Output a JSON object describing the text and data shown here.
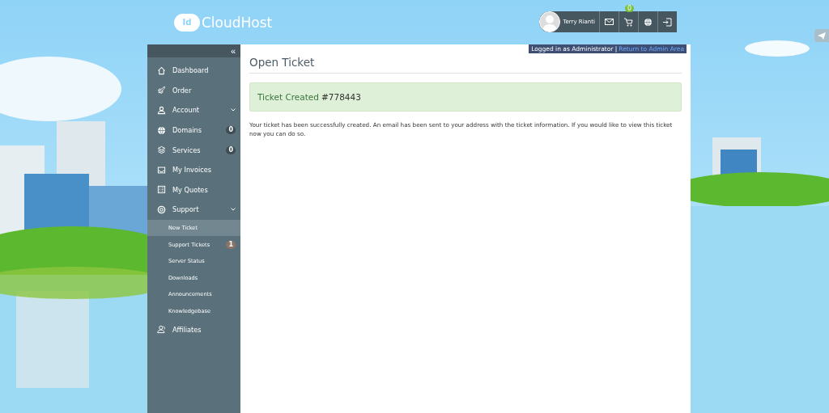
{
  "header": {
    "logo_mark": "Id",
    "logo_text": "CloudHost",
    "user_name": "Terry Rianti",
    "cart_count": "0"
  },
  "admin_bar": {
    "text": "Logged in as Administrator |",
    "link": "Return to Admin Area"
  },
  "sidebar": {
    "collapse": "«",
    "items": [
      {
        "kind": "main",
        "label": "Dashboard",
        "selected": false
      },
      {
        "kind": "main",
        "label": "Order",
        "selected": false
      },
      {
        "kind": "main",
        "label": "Account",
        "expandable": true,
        "selected": false
      },
      {
        "kind": "main",
        "label": "Domains",
        "badge": "0",
        "selected": false
      },
      {
        "kind": "main",
        "label": "Services",
        "badge": "0",
        "selected": false
      },
      {
        "kind": "main",
        "label": "My Invoices",
        "selected": false
      },
      {
        "kind": "main",
        "label": "My Quotes",
        "selected": false
      },
      {
        "kind": "main",
        "label": "Support",
        "expandable": true,
        "selected": false
      },
      {
        "kind": "sub",
        "label": "New Ticket",
        "selected": true
      },
      {
        "kind": "sub",
        "label": "Support Tickets",
        "badge": "1",
        "selected": false
      },
      {
        "kind": "sub",
        "label": "Server Status",
        "selected": false
      },
      {
        "kind": "sub",
        "label": "Downloads",
        "selected": false
      },
      {
        "kind": "sub",
        "label": "Announcements",
        "selected": false
      },
      {
        "kind": "sub",
        "label": "Knowledgebase",
        "selected": false
      },
      {
        "kind": "main",
        "label": "Affiliates",
        "selected": false
      }
    ]
  },
  "content": {
    "title": "Open Ticket",
    "alert": {
      "label": "Ticket Created",
      "number": "#778443"
    },
    "message": "Your ticket has been successfully created. An email has been sent to your address with the ticket information. If you would like to view this ticket now you can do so."
  }
}
